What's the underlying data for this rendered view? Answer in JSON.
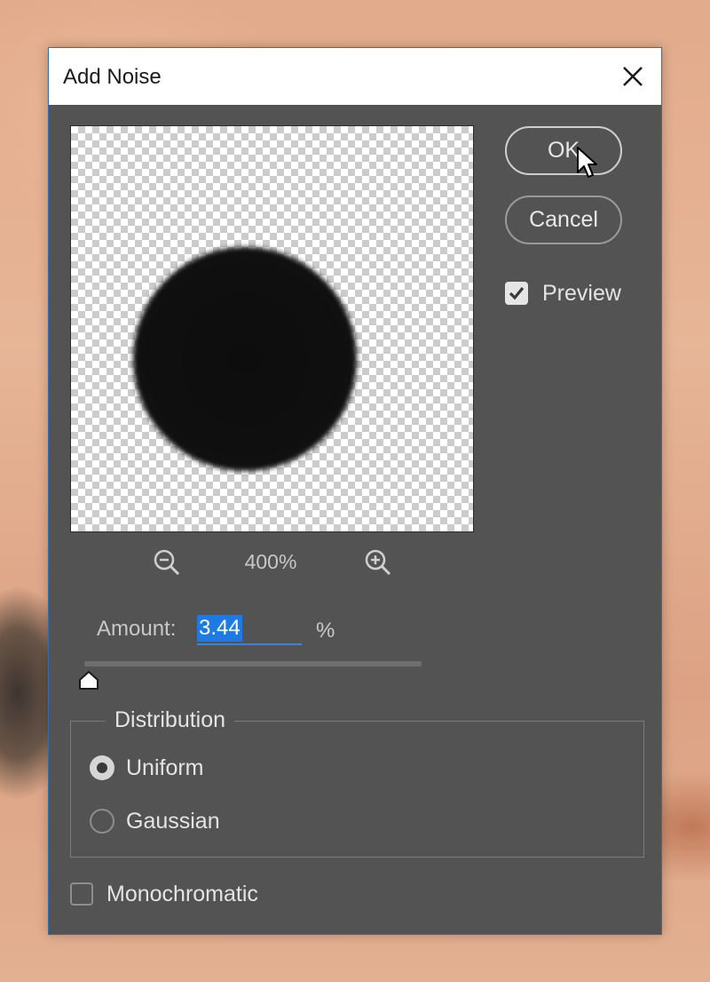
{
  "dialog": {
    "title": "Add Noise",
    "close_icon": "close-icon"
  },
  "preview": {
    "zoom_level": "400%",
    "zoom_out_icon": "zoom-out-icon",
    "zoom_in_icon": "zoom-in-icon"
  },
  "buttons": {
    "ok_label": "OK",
    "cancel_label": "Cancel"
  },
  "preview_toggle": {
    "label": "Preview",
    "checked": true
  },
  "amount": {
    "label": "Amount:",
    "value": "3.44",
    "unit": "%",
    "slider_fraction": 0.0086
  },
  "distribution": {
    "legend": "Distribution",
    "options": [
      {
        "label": "Uniform",
        "selected": true
      },
      {
        "label": "Gaussian",
        "selected": false
      }
    ]
  },
  "monochromatic": {
    "label": "Monochromatic",
    "checked": false
  },
  "colors": {
    "dialog_bg": "#535353",
    "accent": "#1e7ae0"
  }
}
